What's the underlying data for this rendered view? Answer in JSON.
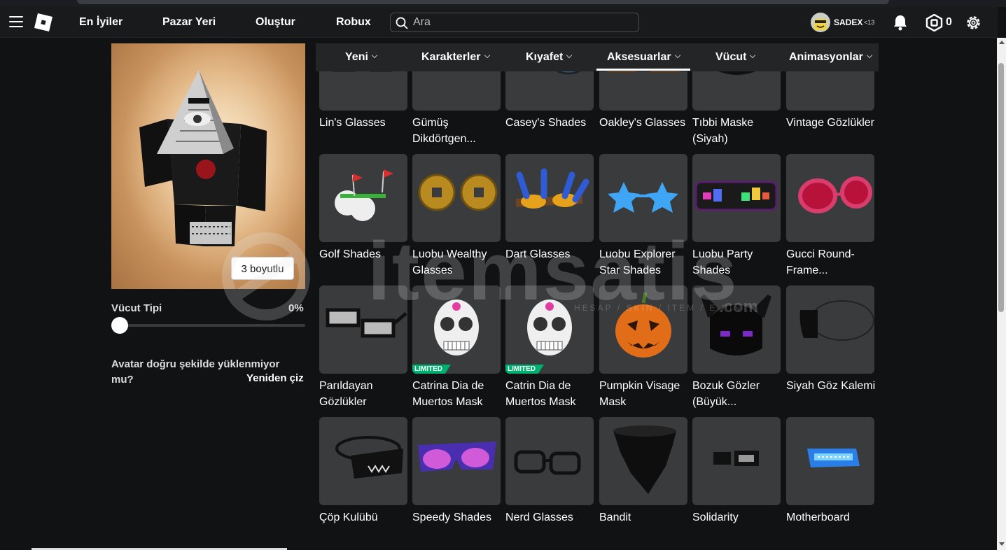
{
  "nav": {
    "links": [
      "En İyiler",
      "Pazar Yeri",
      "Oluştur",
      "Robux"
    ],
    "search_placeholder": "Ara",
    "username": "SADEX",
    "age_badge": "<13",
    "robux": "0"
  },
  "categories": {
    "tabs": [
      "Yeni",
      "Karakterler",
      "Kıyafet",
      "Aksesuarlar",
      "Vücut",
      "Animasyonlar"
    ],
    "active": "Aksesuarlar"
  },
  "avatar": {
    "button_3d": "3 boyutlu",
    "body_type_label": "Vücut Tipi",
    "body_type_value": "0%",
    "body_type_level": 0,
    "issue_text": "Avatar doğru şekilde yüklenmiyor mu?",
    "redraw_label": "Yeniden çiz"
  },
  "items": [
    {
      "name": "Lin's Glasses",
      "icon": "black-glasses-icon"
    },
    {
      "name": "Gümüş Dikdörtgen...",
      "icon": "rectangle-glasses-icon"
    },
    {
      "name": "Casey's Shades",
      "icon": "aviator-shades-icon"
    },
    {
      "name": "Oakley's Glasses",
      "icon": "brown-glasses-icon"
    },
    {
      "name": "Tıbbi Maske (Siyah)",
      "icon": "medical-mask-icon"
    },
    {
      "name": "Vintage Gözlükler",
      "icon": "vintage-glasses-icon"
    },
    {
      "name": "Golf Shades",
      "icon": "golf-shades-icon"
    },
    {
      "name": "Luobu Wealthy Glasses",
      "icon": "coin-glasses-icon"
    },
    {
      "name": "Dart Glasses",
      "icon": "dart-glasses-icon"
    },
    {
      "name": "Luobu Explorer Star Shades",
      "icon": "star-shades-icon"
    },
    {
      "name": "Luobu Party Shades",
      "icon": "party-shades-icon"
    },
    {
      "name": "Gucci Round-Frame...",
      "icon": "pink-round-glasses-icon"
    },
    {
      "name": "Parıldayan Gözlükler",
      "icon": "white-glasses-icon"
    },
    {
      "name": "Catrina Dia de Muertos Mask",
      "icon": "skull-mask-icon",
      "limited": "LIMITED"
    },
    {
      "name": "Catrin Dia de Muertos Mask",
      "icon": "skull-mask-icon",
      "limited": "LIMITED"
    },
    {
      "name": "Pumpkin Visage Mask",
      "icon": "pumpkin-mask-icon"
    },
    {
      "name": "Bozuk Gözler (Büyük...",
      "icon": "horned-eyes-icon"
    },
    {
      "name": "Siyah Göz Kalemi",
      "icon": "eye-patch-icon"
    },
    {
      "name": "Çöp Kulübü",
      "icon": "trash-club-mask-icon"
    },
    {
      "name": "Speedy Shades",
      "icon": "purple-shades-icon"
    },
    {
      "name": "Nerd Glasses",
      "icon": "nerd-glasses-icon"
    },
    {
      "name": "Bandit",
      "icon": "bandit-mask-icon"
    },
    {
      "name": "Solidarity",
      "icon": "solidarity-glasses-icon"
    },
    {
      "name": "Motherboard",
      "icon": "motherboard-visor-icon"
    }
  ],
  "watermark": {
    "text": "itemsatis",
    "subtitle": "HESAP / SKIN / ITEM / E-PIN",
    "suffix": ".com"
  }
}
